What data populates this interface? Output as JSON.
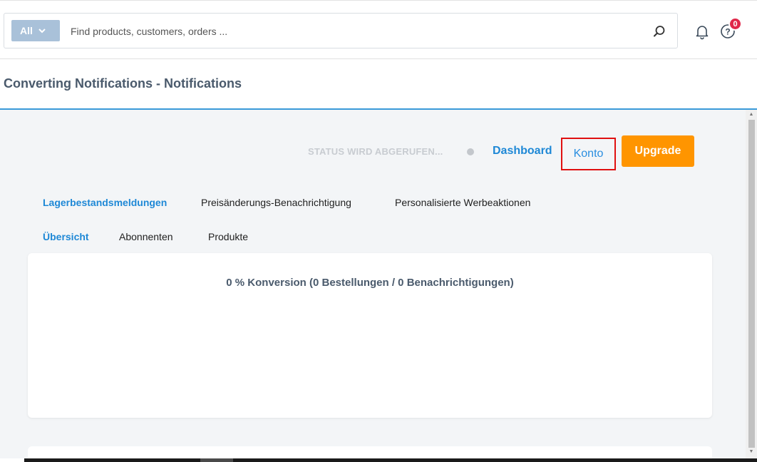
{
  "search": {
    "scope_label": "All",
    "placeholder": "Find products, customers, orders ...",
    "value": ""
  },
  "header": {
    "notifications_icon": "bell-icon",
    "help_icon": "help-icon",
    "help_badge_count": "0"
  },
  "page": {
    "title": "Converting Notifications - Notifications"
  },
  "toolbar": {
    "status_text": "STATUS WIRD ABGERUFEN...",
    "dashboard_label": "Dashboard",
    "konto_label": "Konto",
    "upgrade_label": "Upgrade"
  },
  "main_tabs": [
    {
      "label": "Lagerbestandsmeldungen",
      "active": true
    },
    {
      "label": "Preisänderungs-Benachrichtigung",
      "active": false
    },
    {
      "label": "Personalisierte Werbeaktionen",
      "active": false
    }
  ],
  "sub_tabs": [
    {
      "label": "Übersicht",
      "active": true
    },
    {
      "label": "Abonnenten",
      "active": false
    },
    {
      "label": "Produkte",
      "active": false
    }
  ],
  "overview": {
    "conversion_text": "0 % Konversion (0 Bestellungen / 0 Benachrichtigungen)"
  },
  "colors": {
    "accent": "#1e88d6",
    "upgrade": "#ff9500",
    "badge": "#e0284a",
    "highlight_border": "#e01010"
  }
}
